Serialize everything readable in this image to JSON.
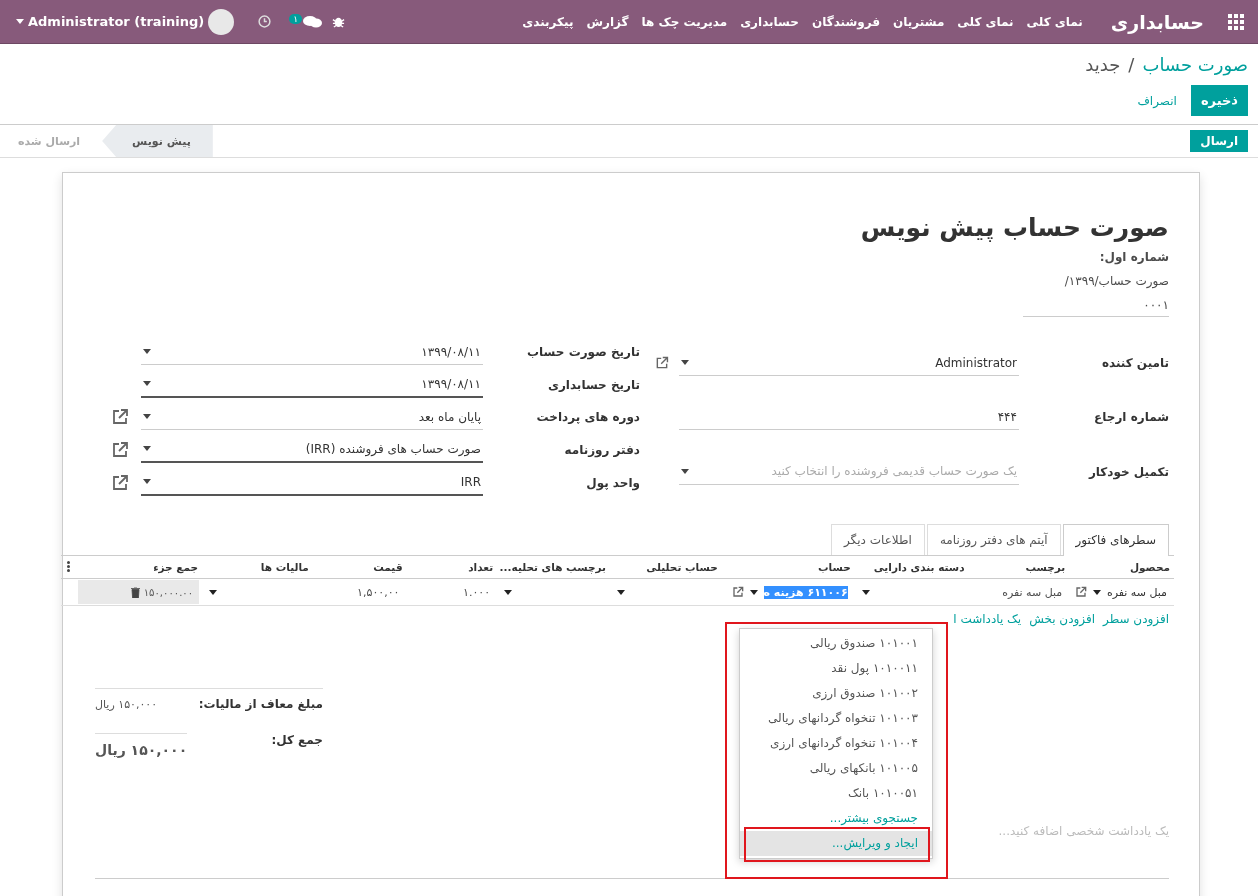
{
  "topbar": {
    "app_name": "حسابداری",
    "menu": [
      "نمای کلی",
      "نمای کلی",
      "مشتریان",
      "فروشندگان",
      "حسابداری",
      "مدیریت چک ها",
      "گزارش",
      "پیکربندی"
    ],
    "chat_badge": "۱",
    "user": "Administrator (training)"
  },
  "breadcrumb": {
    "parent": "صورت حساب",
    "separator": "/",
    "current": "جدید"
  },
  "buttons": {
    "save": "ذخیره",
    "discard": "انصراف"
  },
  "status_bar": {
    "action": "ارسال",
    "stages": [
      {
        "label": "پیش نویس",
        "selected": true
      },
      {
        "label": "ارسال شده",
        "selected": false
      }
    ]
  },
  "sheet": {
    "title": "صورت حساب پیش نویس",
    "number_label": "شماره اول:",
    "number_prefix": "صورت حساب/۱۳۹۹/",
    "number": "۰۰۰۱",
    "fields_right": [
      {
        "label": "تامین کننده",
        "value": "Administrator",
        "kind": "dropdown",
        "external_link": true,
        "required": false
      },
      {
        "label": "شماره ارجاع",
        "value": "۴۴۴",
        "kind": "text",
        "external_link": false,
        "required": false
      },
      {
        "label": "تکمیل خودکار",
        "placeholder": "یک صورت حساب قدیمی فروشنده را انتخاب کنید",
        "kind": "dropdown",
        "external_link": false,
        "required": false
      }
    ],
    "fields_left": [
      {
        "label": "تاریخ صورت حساب",
        "value": "۱۳۹۹/۰۸/۱۱",
        "kind": "dropdown",
        "external_link": false,
        "required": false
      },
      {
        "label": "تاریخ حسابداری",
        "value": "۱۳۹۹/۰۸/۱۱",
        "kind": "dropdown",
        "external_link": false,
        "required": true
      },
      {
        "label": "دوره های پرداخت",
        "value": "پایان ماه بعد",
        "kind": "dropdown",
        "external_link": true,
        "required": false
      },
      {
        "label": "دفتر روزنامه",
        "value": "صورت حساب های فروشنده (IRR)",
        "kind": "dropdown",
        "external_link": true,
        "required": true
      },
      {
        "label": "واحد پول",
        "value": "IRR",
        "kind": "dropdown",
        "external_link": true,
        "required": true
      }
    ],
    "tabs": [
      {
        "label": "سطرهای فاکتور",
        "selected": true
      },
      {
        "label": "آیتم های دفتر روزنامه",
        "selected": false
      },
      {
        "label": "اطلاعات دیگر",
        "selected": false
      }
    ],
    "table": {
      "columns": [
        "محصول",
        "برچسب",
        "دسته بندی دارایی",
        "حساب",
        "حساب تحلیلی",
        "برچسب های تحلیه...",
        "تعداد",
        "قیمت",
        "مالیات ها",
        "جمع جزء"
      ],
      "rows": [
        {
          "cells": [
            {
              "kind": "dropdown",
              "value": "مبل سه نفره",
              "external_link": true,
              "highlighted": false
            },
            {
              "kind": "text",
              "value": "مبل سه نفره"
            },
            {
              "kind": "dropdown",
              "external_link": false
            },
            {
              "kind": "dropdown",
              "value": "۶۱۱۰۰۶ هزینه ه",
              "external_link": true,
              "highlighted": true
            },
            {
              "kind": "dropdown",
              "external_link": false
            },
            {
              "kind": "dropdown",
              "external_link": false
            },
            {
              "kind": "text",
              "value": "۱.۰۰۰"
            },
            {
              "kind": "text",
              "value": "۱,۵۰۰,۰۰"
            },
            {
              "kind": "dropdown",
              "external_link": false
            },
            {
              "kind": "readonly",
              "value": "۱۵۰,۰۰۰.۰۰"
            }
          ]
        }
      ]
    },
    "add_links": [
      "افزودن سطر",
      "افزودن بخش",
      "یک یادداشت ا"
    ],
    "account_dropdown": [
      {
        "label": "۱۰۱۰۰۱ صندوق ریالی",
        "kind": "option",
        "selected": false
      },
      {
        "label": "۱۰۱۰۰۱۱ پول نقد",
        "kind": "option",
        "selected": false
      },
      {
        "label": "۱۰۱۰۰۲ صندوق ارزی",
        "kind": "option",
        "selected": false
      },
      {
        "label": "۱۰۱۰۰۳ تنخواه گردانهای ریالی",
        "kind": "option",
        "selected": false
      },
      {
        "label": "۱۰۱۰۰۴ تنخواه گردانهای ارزی",
        "kind": "option",
        "selected": false
      },
      {
        "label": "۱۰۱۰۰۵ بانکهای ریالی",
        "kind": "option",
        "selected": false
      },
      {
        "label": "۱۰۱۰۰۵۱ بانک",
        "kind": "option",
        "selected": false
      },
      {
        "label": "جستجوی بیشتر...",
        "kind": "action",
        "selected": false
      },
      {
        "label": "ایجاد و ویرایش...",
        "kind": "action",
        "selected": true
      }
    ],
    "totals": [
      {
        "label": "مبلغ معاف از مالیات:",
        "amount": "۱۵۰,۰۰۰ ریال",
        "kind": "subtotal"
      },
      {
        "label": "جمع کل:",
        "amount": "۱۵۰,۰۰۰ ریال",
        "kind": "grand_total"
      }
    ],
    "note_placeholder": "یک یادداشت شخصی اضافه کنید..."
  }
}
